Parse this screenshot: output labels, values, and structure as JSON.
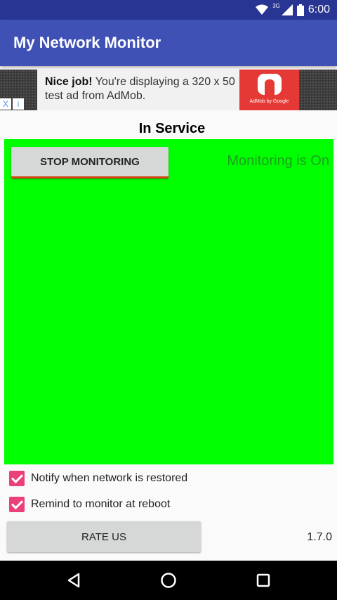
{
  "status_bar": {
    "network_label": "3G",
    "time": "6:00",
    "icons": [
      "wifi-icon",
      "cell-signal-icon",
      "battery-icon"
    ]
  },
  "app_bar": {
    "title": "My Network Monitor"
  },
  "ad": {
    "headline": "Nice job!",
    "body": " You're displaying a 320 x 50 test ad from AdMob.",
    "brand": "AdMob by Google",
    "close_symbol": "X",
    "info_symbol": "i"
  },
  "main": {
    "service_status": "In Service",
    "stop_button_label": "STOP MONITORING",
    "monitoring_status": "Monitoring is On",
    "panel_color": "#00ff00"
  },
  "options": [
    {
      "label": "Notify when network is restored",
      "checked": true
    },
    {
      "label": "Remind to monitor at reboot",
      "checked": true
    }
  ],
  "footer": {
    "rate_button_label": "RATE US",
    "version": "1.7.0"
  },
  "nav": {
    "buttons": [
      "back-icon",
      "home-icon",
      "recents-icon"
    ]
  },
  "colors": {
    "primary": "#3f51b5",
    "primary_dark": "#283593",
    "accent": "#ec407a"
  }
}
